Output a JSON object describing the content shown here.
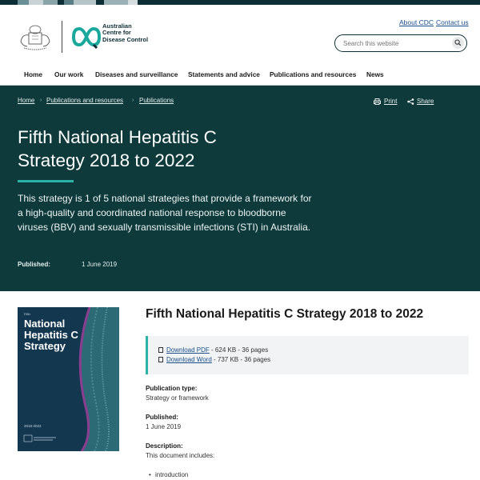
{
  "brand": {
    "org_name": "Australian Centre for Disease Control",
    "crest_label": "Australian Government coat of arms",
    "colors": {
      "primary_dark": "#0e3a3b",
      "accent_teal": "#2bb3a8",
      "link_blue": "#1a4f8b"
    }
  },
  "utility_links": {
    "about": "About CDC",
    "contact": "Contact us"
  },
  "search": {
    "placeholder": "Search this website",
    "icon": "search-icon"
  },
  "nav": {
    "items": [
      "Home",
      "Our work",
      "Diseases and surveillance",
      "Statements and advice",
      "Publications and resources",
      "News"
    ]
  },
  "breadcrumb": [
    "Home",
    "Publications and resources",
    "Publications"
  ],
  "page_actions": {
    "print": "Print",
    "share": "Share"
  },
  "hero": {
    "title": "Fifth National Hepatitis C Strategy 2018 to 2022",
    "description": "This strategy is 1 of 5 national strategies that provide a framework for a high-quality and coordinated national response to bloodborne viruses (BBV) and sexually transmissible infections (STI) in Australia.",
    "published_label": "Published:",
    "published_date": "1 June 2019"
  },
  "cover": {
    "small_text": "Fifth",
    "title": "National Hepatitis C Strategy",
    "years": "2018-2022"
  },
  "document": {
    "title": "Fifth National Hepatitis C Strategy 2018 to 2022",
    "downloads": [
      {
        "link": "Download PDF",
        "meta": " - 624 KB - 36 pages"
      },
      {
        "link": "Download Word",
        "meta": " - 737 KB - 36 pages"
      }
    ],
    "publication_type_label": "Publication type:",
    "publication_type": "Strategy or framework",
    "published_label": "Published:",
    "published_date": "1 June 2019",
    "description_label": "Description:",
    "description": "This document includes:",
    "includes": [
      "introduction"
    ]
  }
}
